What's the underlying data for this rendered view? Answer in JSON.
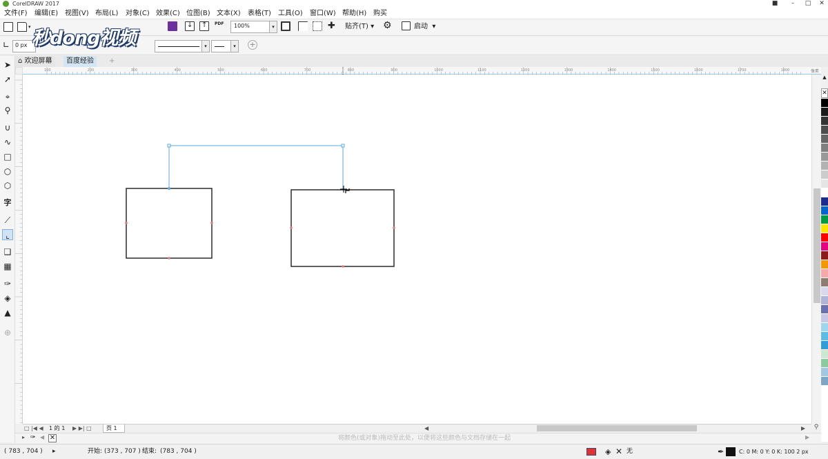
{
  "app": {
    "title": "CorelDRAW 2017"
  },
  "menu": [
    "文件(F)",
    "编辑(E)",
    "视图(V)",
    "布局(L)",
    "对象(C)",
    "效果(C)",
    "位图(B)",
    "文本(X)",
    "表格(T)",
    "工具(O)",
    "窗口(W)",
    "帮助(H)",
    "购买"
  ],
  "toolbar": {
    "zoom_value": "100%",
    "snap_label": "贴齐(T)",
    "launch_label": "启动",
    "pdf_label": "PDF",
    "outline_width": "0 px"
  },
  "watermark": {
    "text": "秒dong视频"
  },
  "tabs": [
    {
      "label": "欢迎屏幕"
    },
    {
      "label": "百度经验"
    }
  ],
  "ruler": {
    "h_labels": [
      "100",
      "200",
      "300",
      "400",
      "500",
      "600",
      "700",
      "800",
      "900",
      "1000",
      "1100",
      "1200",
      "1300",
      "1400",
      "1500",
      "1600",
      "1700",
      "1800"
    ],
    "unit": "像素"
  },
  "page_nav": {
    "current": "1",
    "of_label": "的",
    "total": "1",
    "page_tab": "页 1"
  },
  "doc_palette": {
    "hint": "将颜色(或对象)拖动至此处，以便将这些颜色与文档存储在一起"
  },
  "status": {
    "cursor": "( 783 , 704 )",
    "start_label": "开始:",
    "start_value": "(373 , 707 )",
    "end_label": "结束:",
    "end_value": "(783 , 704 )",
    "fill_label": "无",
    "outline_info": "C: 0 M: 0 Y: 0 K: 100  2 px"
  },
  "colors": {
    "accent": "#2b8ad6",
    "connector": "#5aa8e0",
    "rect_stroke": "#2a2a2a",
    "node_red": "#e87878"
  },
  "palette_swatches": [
    "#000000",
    "#1a1a1a",
    "#333333",
    "#4d4d4d",
    "#666666",
    "#808080",
    "#999999",
    "#b3b3b3",
    "#cccccc",
    "#e5e5e5",
    "#ffffff",
    "#1a2d8c",
    "#0066cc",
    "#009a44",
    "#ffe600",
    "#ff0000",
    "#e4007f",
    "#8b1a1a",
    "#f39800",
    "#f5a9a9",
    "#8c7d70",
    "#d9d9ee",
    "#b0b4d8",
    "#6a6fb0",
    "#c6c6e8",
    "#9fd6ee",
    "#5bbce4",
    "#2f9ed8",
    "#cde7d0",
    "#8ccaa0",
    "#a0c8e0",
    "#7aa7c7"
  ]
}
